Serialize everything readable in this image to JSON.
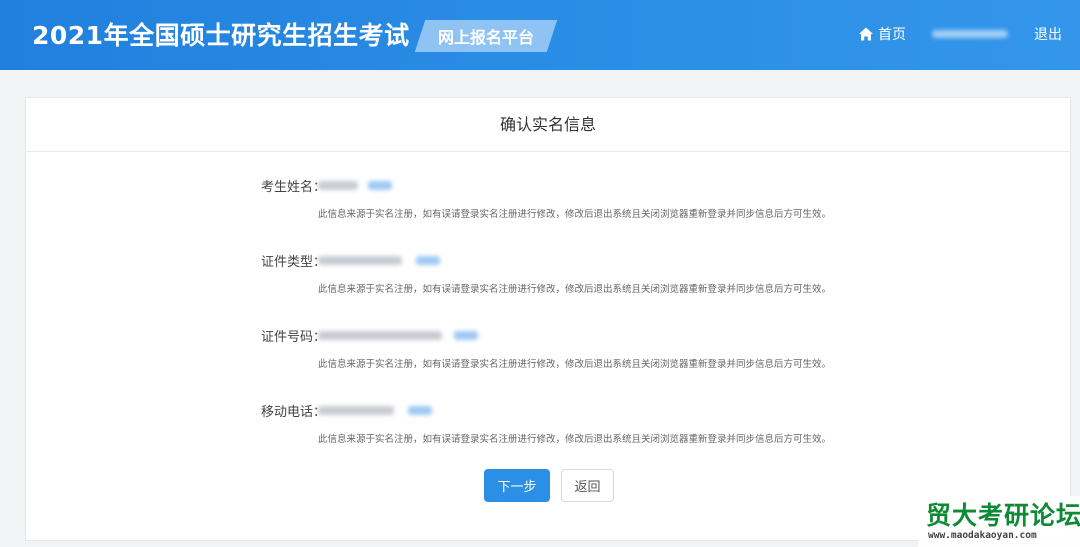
{
  "header": {
    "title": "2021年全国硕士研究生招生考试",
    "platform": "网上报名平台",
    "home_label": "首页",
    "logout_label": "退出"
  },
  "panel": {
    "title": "确认实名信息",
    "fields": [
      {
        "label": "考生姓名：",
        "note": "此信息来源于实名注册，如有误请登录实名注册进行修改，修改后退出系统且关闭浏览器重新登录并同步信息后方可生效。"
      },
      {
        "label": "证件类型：",
        "note": "此信息来源于实名注册，如有误请登录实名注册进行修改，修改后退出系统且关闭浏览器重新登录并同步信息后方可生效。"
      },
      {
        "label": "证件号码：",
        "note": "此信息来源于实名注册，如有误请登录实名注册进行修改，修改后退出系统且关闭浏览器重新登录并同步信息后方可生效。"
      },
      {
        "label": "移动电话：",
        "note": "此信息来源于实名注册，如有误请登录实名注册进行修改，修改后退出系统且关闭浏览器重新登录并同步信息后方可生效。"
      }
    ],
    "next_label": "下一步",
    "back_label": "返回"
  },
  "watermark": {
    "title": "贸大考研论坛",
    "url": "www.maodakaoyan.com"
  },
  "colors": {
    "header_blue": "#2180de",
    "primary_button": "#2b8fe6",
    "watermark_green": "#0e8a35"
  }
}
